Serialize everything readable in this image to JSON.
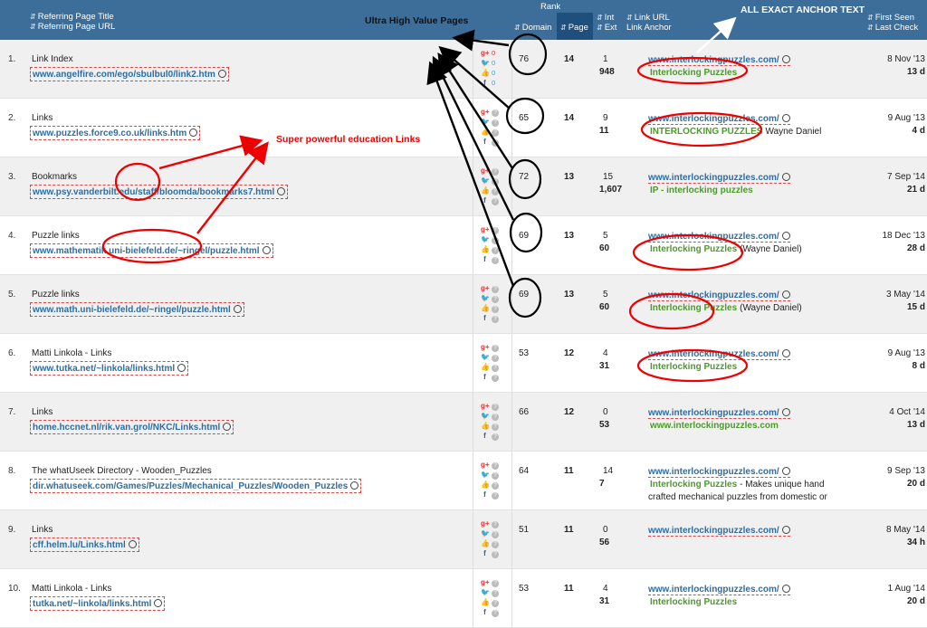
{
  "header": {
    "referring_title": "Referring Page Title",
    "referring_url": "Referring Page URL",
    "rank": "Rank",
    "domain": "Domain",
    "page": "Page",
    "int": "Int",
    "ext": "Ext",
    "link_url": "Link URL",
    "link_anchor": "Link Anchor",
    "first_seen": "First Seen",
    "last_check": "Last Check",
    "sort_glyph": "⇵"
  },
  "annotations": {
    "ultra_high_value": "Ultra High Value Pages",
    "exact_anchor": "ALL EXACT ANCHOR TEXT",
    "education_links": "Super powerful education Links"
  },
  "colors": {
    "header_bg": "#3d6e99",
    "active_col": "#1f4f7d",
    "annotation_red": "#e00000",
    "anchor_green": "#4c9a2a",
    "link_blue": "#2f6da0"
  },
  "social_icons": [
    "google-plus-icon",
    "twitter-icon",
    "like-icon",
    "facebook-icon"
  ],
  "rows": [
    {
      "num": "1.",
      "title": "Link Index",
      "url": "www.angelfire.com/ego/sbulbul0/link2.htm",
      "social": [
        "0",
        "0",
        "0",
        "0"
      ],
      "domain": "76",
      "page": "14",
      "int": "1",
      "ext": "948",
      "link_url": "www.interlockingpuzzles.com/",
      "anchor": "Interlocking Puzzles",
      "anchor_suffix": "",
      "anchor_line2": "",
      "first_seen": "8 Nov '13",
      "last_check": "13 d"
    },
    {
      "num": "2.",
      "title": "Links",
      "url": "www.puzzles.force9.co.uk/links.htm",
      "social": [
        "?",
        "?",
        "?",
        "?"
      ],
      "domain": "65",
      "page": "14",
      "int": "9",
      "ext": "11",
      "link_url": "www.interlockingpuzzles.com/",
      "anchor": "INTERLOCKING PUZZLES",
      "anchor_suffix": "Wayne Daniel",
      "anchor_line2": "",
      "first_seen": "9 Aug '13",
      "last_check": "4 d"
    },
    {
      "num": "3.",
      "title": "Bookmarks",
      "url": "www.psy.vanderbilt.edu/staff/bloomda/bookmarks7.html",
      "social": [
        "?",
        "?",
        "?",
        "?"
      ],
      "domain": "72",
      "page": "13",
      "int": "15",
      "ext": "1,607",
      "link_url": "www.interlockingpuzzles.com/",
      "anchor": "IP - interlocking puzzles",
      "anchor_suffix": "",
      "anchor_line2": "",
      "first_seen": "7 Sep '14",
      "last_check": "21 d"
    },
    {
      "num": "4.",
      "title": "Puzzle links",
      "url": "www.mathematik.uni-bielefeld.de/~ringel/puzzle.html",
      "social": [
        "?",
        "?",
        "?",
        "?"
      ],
      "domain": "69",
      "page": "13",
      "int": "5",
      "ext": "60",
      "link_url": "www.interlockingpuzzles.com/",
      "anchor": "Interlocking Puzzles",
      "anchor_suffix": "(Wayne Daniel)",
      "anchor_line2": "",
      "first_seen": "18 Dec '13",
      "last_check": "28 d"
    },
    {
      "num": "5.",
      "title": "Puzzle links",
      "url": "www.math.uni-bielefeld.de/~ringel/puzzle.html",
      "social": [
        "?",
        "?",
        "?",
        "?"
      ],
      "domain": "69",
      "page": "13",
      "int": "5",
      "ext": "60",
      "link_url": "www.interlockingpuzzles.com/",
      "anchor": "Interlocking Puzzles",
      "anchor_suffix": "(Wayne Daniel)",
      "anchor_line2": "",
      "first_seen": "3 May '14",
      "last_check": "15 d"
    },
    {
      "num": "6.",
      "title": "Matti Linkola - Links",
      "url": "www.tutka.net/~linkola/links.html",
      "social": [
        "?",
        "?",
        "?",
        "?"
      ],
      "domain": "53",
      "page": "12",
      "int": "4",
      "ext": "31",
      "link_url": "www.interlockingpuzzles.com/",
      "anchor": "Interlocking Puzzles",
      "anchor_suffix": "",
      "anchor_line2": "",
      "first_seen": "9 Aug '13",
      "last_check": "8 d"
    },
    {
      "num": "7.",
      "title": "Links",
      "url": "home.hccnet.nl/rik.van.grol/NKC/Links.html",
      "social": [
        "?",
        "?",
        "?",
        "?"
      ],
      "domain": "66",
      "page": "12",
      "int": "0",
      "ext": "53",
      "link_url": "www.interlockingpuzzles.com/",
      "anchor": "www.interlockingpuzzles.com",
      "anchor_suffix": "",
      "anchor_line2": "",
      "first_seen": "4 Oct '14",
      "last_check": "13 d"
    },
    {
      "num": "8.",
      "title": "The whatUseek Directory - Wooden_Puzzles",
      "url": "dir.whatuseek.com/Games/Puzzles/Mechanical_Puzzles/Wooden_Puzzles",
      "social": [
        "?",
        "?",
        "?",
        "?"
      ],
      "domain": "64",
      "page": "11",
      "int": "14",
      "ext": "7",
      "link_url": "www.interlockingpuzzles.com/",
      "anchor": "Interlocking Puzzles",
      "anchor_suffix": "- Makes unique hand",
      "anchor_line2": "crafted mechanical puzzles from domestic or",
      "first_seen": "9 Sep '13",
      "last_check": "20 d"
    },
    {
      "num": "9.",
      "title": "Links",
      "url": "cff.helm.lu/Links.html",
      "social": [
        "?",
        "?",
        "?",
        "?"
      ],
      "domain": "51",
      "page": "11",
      "int": "0",
      "ext": "56",
      "link_url": "www.interlockingpuzzles.com/",
      "anchor": "",
      "anchor_suffix": "",
      "anchor_line2": "",
      "first_seen": "8 May '14",
      "last_check": "34 h"
    },
    {
      "num": "10.",
      "title": "Matti Linkola - Links",
      "url": "tutka.net/~linkola/links.html",
      "social": [
        "?",
        "?",
        "?",
        "?"
      ],
      "domain": "53",
      "page": "11",
      "int": "4",
      "ext": "31",
      "link_url": "www.interlockingpuzzles.com/",
      "anchor": "Interlocking Puzzles",
      "anchor_suffix": "",
      "anchor_line2": "",
      "first_seen": "1 Aug '14",
      "last_check": "20 d"
    }
  ]
}
